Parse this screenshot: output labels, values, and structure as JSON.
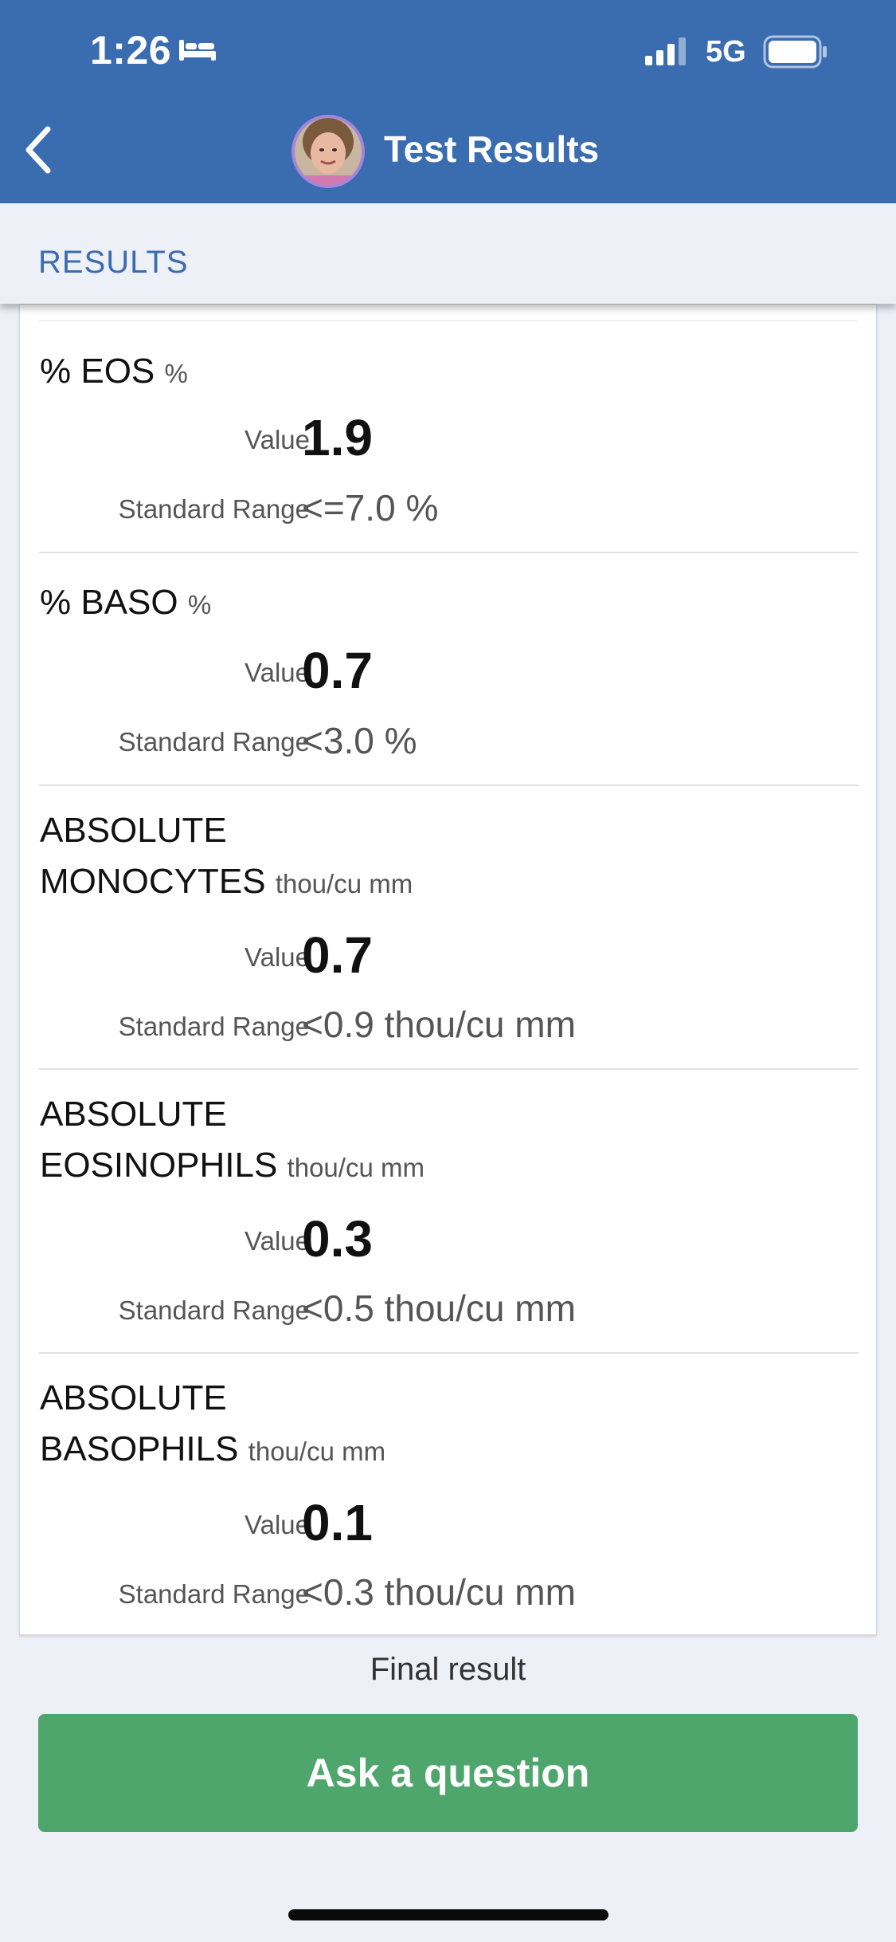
{
  "status_bar": {
    "time": "1:26",
    "network": "5G",
    "sleep_icon": "bed-icon",
    "signal_icon": "cellular-signal-icon",
    "battery_icon": "battery-icon"
  },
  "nav": {
    "title": "Test Results",
    "back_icon": "chevron-left-icon",
    "color": "#3a6cb0"
  },
  "section": {
    "title": "RESULTS"
  },
  "results": [
    {
      "name_line1": "% EOS",
      "name_line2": "",
      "unit": "%",
      "value_label": "Value",
      "value": "1.9",
      "range_label": "Standard Range",
      "range": "<=7.0 %"
    },
    {
      "name_line1": "% BASO",
      "name_line2": "",
      "unit": "%",
      "value_label": "Value",
      "value": "0.7",
      "range_label": "Standard Range",
      "range": "<3.0 %"
    },
    {
      "name_line1": "ABSOLUTE",
      "name_line2": "MONOCYTES",
      "unit": "thou/cu mm",
      "value_label": "Value",
      "value": "0.7",
      "range_label": "Standard Range",
      "range": "<0.9 thou/cu mm"
    },
    {
      "name_line1": "ABSOLUTE",
      "name_line2": "EOSINOPHILS",
      "unit": "thou/cu mm",
      "value_label": "Value",
      "value": "0.3",
      "range_label": "Standard Range",
      "range": "<0.5 thou/cu mm"
    },
    {
      "name_line1": "ABSOLUTE",
      "name_line2": "BASOPHILS",
      "unit": "thou/cu mm",
      "value_label": "Value",
      "value": "0.1",
      "range_label": "Standard Range",
      "range": "<0.3 thou/cu mm"
    }
  ],
  "footer": {
    "final_result": "Final result",
    "ask_button": "Ask a question",
    "ask_button_color": "#4ea66c"
  }
}
